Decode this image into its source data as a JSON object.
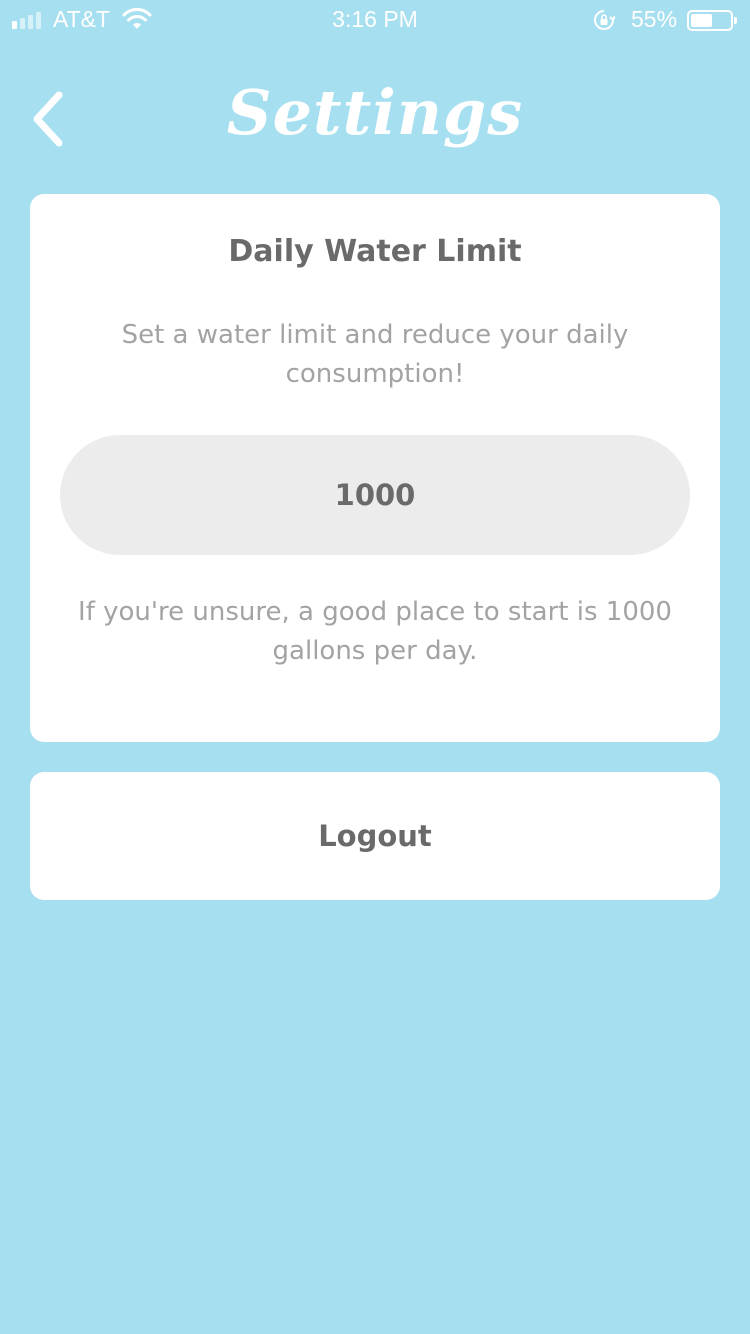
{
  "status_bar": {
    "carrier": "AT&T",
    "time": "3:16 PM",
    "battery_percent_label": "55%",
    "battery_level": 0.55,
    "icons": [
      "signal-icon",
      "wifi-icon",
      "orientation-lock-icon",
      "battery-icon"
    ]
  },
  "header": {
    "title": "Settings",
    "back_icon": "chevron-left-icon"
  },
  "limit_card": {
    "title": "Daily Water Limit",
    "description": "Set a water limit and reduce your daily consumption!",
    "input_value": "1000",
    "hint": "If you're unsure, a good place to start is 1000 gallons per day."
  },
  "logout": {
    "label": "Logout"
  },
  "colors": {
    "background": "#a6dff0",
    "card": "#ffffff",
    "input_bg": "#ececec",
    "text_dark": "#6a6a6a",
    "text_light": "#a3a3a3"
  }
}
